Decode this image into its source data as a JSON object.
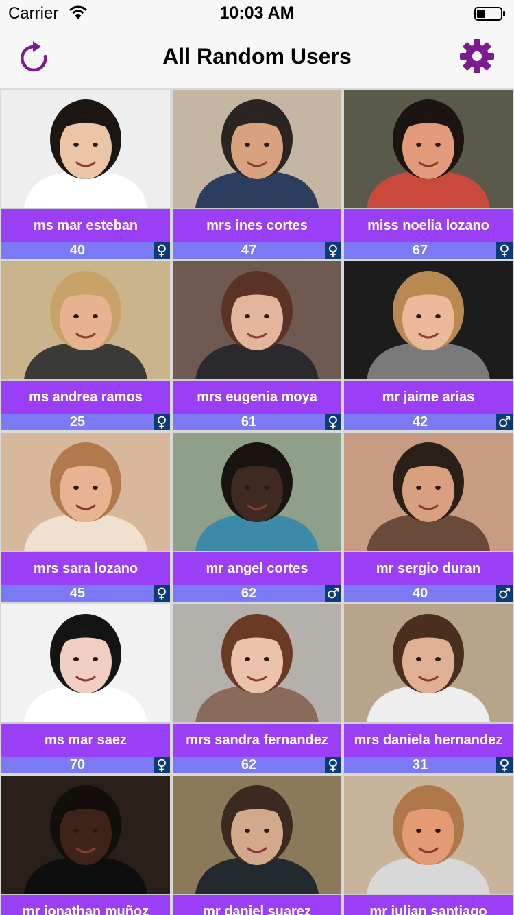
{
  "status_bar": {
    "carrier": "Carrier",
    "time": "10:03 AM"
  },
  "nav": {
    "title": "All Random Users"
  },
  "colors": {
    "accent": "#7c1b8f",
    "name_bar": "#9b3ff7",
    "info_bar": "#7c79f4",
    "gender_badge": "#0b3c73"
  },
  "users": [
    {
      "name": "ms mar esteban",
      "age": "40",
      "gender_icon": "♀",
      "gender_icon_name": "female-icon",
      "bg": "#eeeeee",
      "hair": "#1c1612",
      "skin": "#ecc4a6",
      "shirt": "#ffffff"
    },
    {
      "name": "mrs ines cortes",
      "age": "47",
      "gender_icon": "♀",
      "gender_icon_name": "female-icon",
      "bg": "#c4b6a2",
      "hair": "#2b2522",
      "skin": "#d9a27e",
      "shirt": "#2c3e5e"
    },
    {
      "name": "miss noelia lozano",
      "age": "67",
      "gender_icon": "♀",
      "gender_icon_name": "female-icon",
      "bg": "#5a5a4a",
      "hair": "#1c1410",
      "skin": "#e39a7a",
      "shirt": "#c94a3a"
    },
    {
      "name": "ms andrea ramos",
      "age": "25",
      "gender_icon": "♀",
      "gender_icon_name": "female-icon",
      "bg": "#c9b48c",
      "hair": "#c9a26a",
      "skin": "#e6b28f",
      "shirt": "#3a3a36"
    },
    {
      "name": "mrs eugenia moya",
      "age": "61",
      "gender_icon": "♀",
      "gender_icon_name": "female-icon",
      "bg": "#6e5a50",
      "hair": "#5a3226",
      "skin": "#e4b59c",
      "shirt": "#2a2a2e"
    },
    {
      "name": "mr jaime arias",
      "age": "42",
      "gender_icon": "♂",
      "gender_icon_name": "male-icon",
      "bg": "#1c1c1c",
      "hair": "#b88a52",
      "skin": "#eab99a",
      "shirt": "#7a7a7a"
    },
    {
      "name": "mrs sara lozano",
      "age": "45",
      "gender_icon": "♀",
      "gender_icon_name": "female-icon",
      "bg": "#d8b89c",
      "hair": "#b27a4c",
      "skin": "#e8b393",
      "shirt": "#f0e0d0"
    },
    {
      "name": "mr angel cortes",
      "age": "62",
      "gender_icon": "♂",
      "gender_icon_name": "male-icon",
      "bg": "#8fa08a",
      "hair": "#1a1410",
      "skin": "#3e2a20",
      "shirt": "#3a8aa8"
    },
    {
      "name": "mr sergio duran",
      "age": "40",
      "gender_icon": "♂",
      "gender_icon_name": "male-icon",
      "bg": "#c89c82",
      "hair": "#2a2018",
      "skin": "#d9a080",
      "shirt": "#6a4a3a"
    },
    {
      "name": "ms mar saez",
      "age": "70",
      "gender_icon": "♀",
      "gender_icon_name": "female-icon",
      "bg": "#f2f2f2",
      "hair": "#141414",
      "skin": "#f0cfc2",
      "shirt": "#ffffff"
    },
    {
      "name": "mrs sandra fernandez",
      "age": "62",
      "gender_icon": "♀",
      "gender_icon_name": "female-icon",
      "bg": "#b4b0ac",
      "hair": "#6a3a24",
      "skin": "#ecc2ac",
      "shirt": "#8a6a5a"
    },
    {
      "name": "mrs daniela hernandez",
      "age": "31",
      "gender_icon": "♀",
      "gender_icon_name": "female-icon",
      "bg": "#b8a48a",
      "hair": "#4a2e20",
      "skin": "#e0b094",
      "shirt": "#eeeeee"
    },
    {
      "name": "mr jonathan muñoz",
      "age": "",
      "gender_icon": "",
      "gender_icon_name": "",
      "bg": "#2a1e18",
      "hair": "#140e0a",
      "skin": "#3e2418",
      "shirt": "#0e0e0e"
    },
    {
      "name": "mr daniel suarez",
      "age": "",
      "gender_icon": "",
      "gender_icon_name": "",
      "bg": "#8a7a5a",
      "hair": "#3a2a20",
      "skin": "#d4a88a",
      "shirt": "#222a30"
    },
    {
      "name": "mr julian santiago",
      "age": "",
      "gender_icon": "",
      "gender_icon_name": "",
      "bg": "#c8b49a",
      "hair": "#b0784a",
      "skin": "#e49a74",
      "shirt": "#d8d8d8"
    }
  ]
}
